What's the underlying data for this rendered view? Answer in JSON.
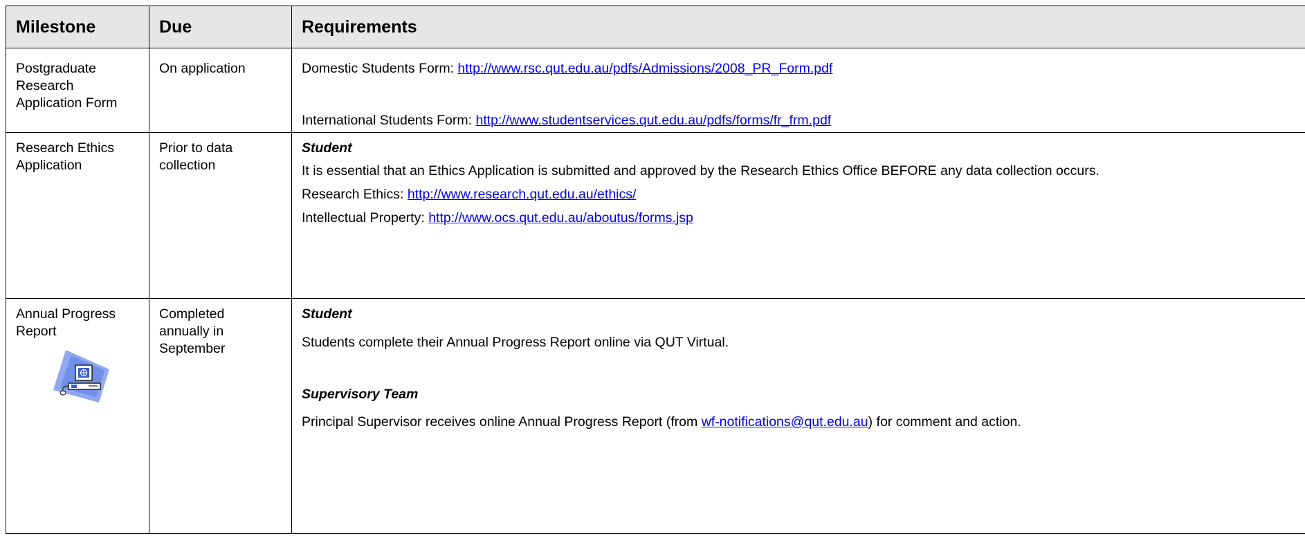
{
  "table": {
    "headers": [
      "Milestone",
      "Due",
      "Requirements"
    ],
    "rows": [
      {
        "milestone": "Postgraduate Research Application Form",
        "due": "On application",
        "domestic_label": "Domestic Students Form: ",
        "domestic_link": "http://www.rsc.qut.edu.au/pdfs/Admissions/2008_PR_Form.pdf",
        "international_label": "International Students Form: ",
        "international_link": "http://www.studentservices.qut.edu.au/pdfs/forms/fr_frm.pdf"
      },
      {
        "milestone": "Research Ethics Application",
        "due": "Prior to data collection",
        "student_heading": "Student",
        "essential_text": "It is essential that an Ethics Application is submitted and approved by the Research Ethics Office BEFORE any data collection occurs.",
        "ethics_label": "Research Ethics: ",
        "ethics_link": "http://www.research.qut.edu.au/ethics/",
        "ip_label": "Intellectual Property: ",
        "ip_link": "http://www.ocs.qut.edu.au/aboutus/forms.jsp"
      },
      {
        "milestone": "Annual Progress Report",
        "due": "Completed annually in September",
        "icon": "computer-icon",
        "student_heading": "Student",
        "student_text": "Students complete their Annual Progress Report online via QUT Virtual.",
        "supervisory_heading": "Supervisory Team",
        "supervisor_text_before": "Principal Supervisor receives online Annual Progress Report (from ",
        "supervisor_link": "wf-notifications@qut.edu.au",
        "supervisor_text_after": ") for comment and action."
      }
    ]
  }
}
